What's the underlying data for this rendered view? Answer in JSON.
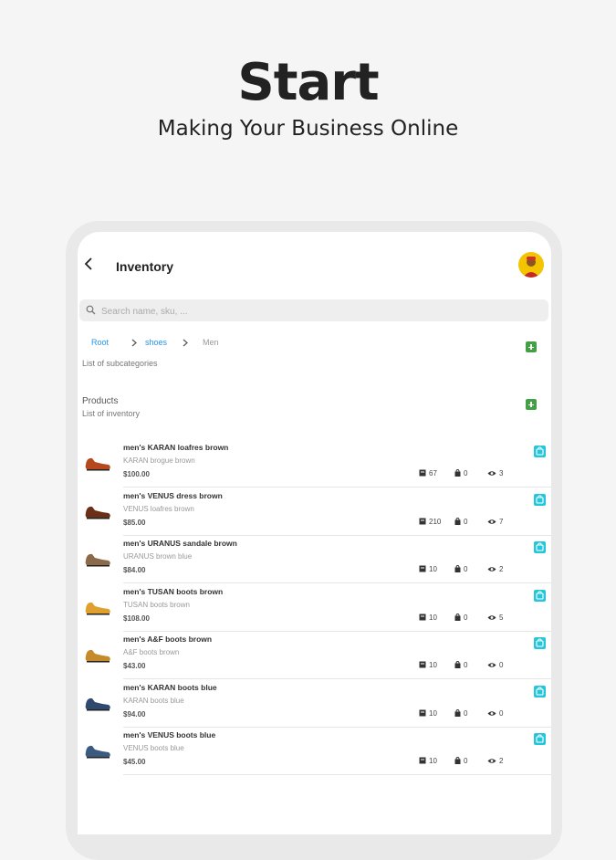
{
  "hero": {
    "title": "Start",
    "subtitle": "Making Your Business Online"
  },
  "app": {
    "title": "Inventory",
    "search_placeholder": "Search name, sku, ...",
    "breadcrumbs": [
      "Root",
      "shoes",
      "Men"
    ],
    "subcategories_label": "List of subcategories",
    "products_heading": "Products",
    "products_sub": "List of inventory"
  },
  "products": [
    {
      "name": "men's KARAN loafres  brown",
      "desc": "KARAN brogue brown",
      "price": "$100.00",
      "stock": "67",
      "orders": "0",
      "views": "3",
      "color": "#b5481c"
    },
    {
      "name": "men's VENUS dress brown",
      "desc": "VENUS loafres brown",
      "price": "$85.00",
      "stock": "210",
      "orders": "0",
      "views": "7",
      "color": "#6b2f17"
    },
    {
      "name": "men's URANUS sandale brown",
      "desc": "URANUS brown blue",
      "price": "$84.00",
      "stock": "10",
      "orders": "0",
      "views": "2",
      "color": "#8a6a4a"
    },
    {
      "name": "men's TUSAN boots brown",
      "desc": "TUSAN boots brown",
      "price": "$108.00",
      "stock": "10",
      "orders": "0",
      "views": "5",
      "color": "#e0a030"
    },
    {
      "name": "men's A&F boots brown",
      "desc": "A&F boots brown",
      "price": "$43.00",
      "stock": "10",
      "orders": "0",
      "views": "0",
      "color": "#c48a2c"
    },
    {
      "name": "men's KARAN boots blue",
      "desc": "KARAN boots blue",
      "price": "$94.00",
      "stock": "10",
      "orders": "0",
      "views": "0",
      "color": "#2f4a6e"
    },
    {
      "name": "men's VENUS boots blue",
      "desc": "VENUS boots blue",
      "price": "$45.00",
      "stock": "10",
      "orders": "0",
      "views": "2",
      "color": "#3a5a80"
    }
  ],
  "icons": {
    "back": "back-arrow-icon",
    "search": "search-icon",
    "add": "add-icon",
    "stock": "box-icon",
    "orders": "bag-icon",
    "views": "eye-icon",
    "action": "shopping-bag-icon"
  },
  "colors": {
    "accent": "#2196f3",
    "add": "#43a047",
    "action": "#26c6da",
    "avatar": "#f3c400"
  }
}
